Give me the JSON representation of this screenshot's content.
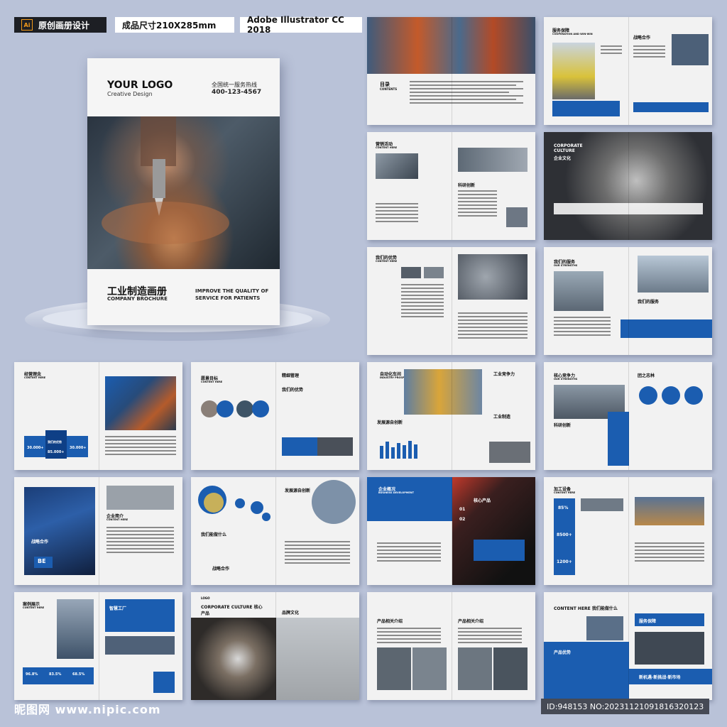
{
  "header": {
    "ai_label": "Ai",
    "tag1": "原创画册设计",
    "tag2": "成品尺寸210X285mm",
    "tag3": "Adobe Illustrator CC 2018"
  },
  "cover": {
    "logo": "YOUR LOGO",
    "logo_sub": "Creative Design",
    "hotline": "全国统一服务热线",
    "phone": "400-123-4567",
    "title": "工业制造画册",
    "title_en": "COMPANY BROCHURE",
    "slogan": "IMPROVE THE QUALITY OF SERVICE FOR PATIENTS"
  },
  "spreads": {
    "s1": {
      "title": "目录",
      "sub": "CONTENTS"
    },
    "s2": {
      "title_left": "服务保障",
      "sub_left": "COOPERATION AND WIN-WIN",
      "title_right": "战略合作"
    },
    "s3": {
      "title": "营销活动",
      "sub": "CONTENT HERE",
      "right": "科研创新"
    },
    "s4": {
      "title": "CORPORATE CULTURE",
      "sub": "企业文化"
    },
    "s5": {
      "title": "我们的优势",
      "sub": "CONTENT HERE"
    },
    "s6": {
      "title": "我们的服务",
      "sub": "OUR STRENGTHS",
      "right": "我们的服务"
    },
    "s7": {
      "title": "经营理念",
      "sub": "CONTENT HERE",
      "stat1": "30.000+",
      "stat2": "85.000+",
      "stat3": "30.000+",
      "center": "我们的优势"
    },
    "s8": {
      "title": "愿景目标",
      "sub": "CONTENT HERE",
      "right": "精细管理",
      "right2": "我们的优势"
    },
    "s9": {
      "title": "自动化车间",
      "sub": "INDUSTRY PROSPECTS",
      "right": "工业竞争力",
      "right2": "工业制造",
      "mid": "发展源自创新"
    },
    "s10": {
      "title": "核心竞争力",
      "sub": "OUR STRENGTHS",
      "right": "团之志林",
      "left2": "科研创新"
    },
    "s11": {
      "title": "企业简介",
      "sub": "CONTENT HERE",
      "badge": "BE",
      "left": "战略合作"
    },
    "s12": {
      "title": "发展源自创新",
      "left": "我们能做什么",
      "left2": "战略合作"
    },
    "s13": {
      "title": "企业概况",
      "sub": "BUSINESS DEVELOPMENT",
      "right": "核心产品",
      "num1": "01",
      "num2": "02"
    },
    "s14": {
      "title": "加工设备",
      "sub": "CONTENT HERE",
      "stat1": "85%",
      "stat2": "8500+",
      "stat3": "1200+"
    },
    "s15": {
      "title": "案例展示",
      "sub": "CONTENT HERE",
      "right": "智慧工厂",
      "stat1": "96.8%",
      "stat2": "83.5%",
      "stat3": "68.5%"
    },
    "s16": {
      "title": "CORPORATE CULTURE 核心产品",
      "right": "品牌文化",
      "logo": "LOGO"
    },
    "s17": {
      "title": "产品相关介绍",
      "right": "产品相关介绍"
    },
    "s18": {
      "title": "CONTENT HERE 我们能做什么",
      "right": "服务保障",
      "blue": "产品优势",
      "banner": "新机遇·新挑战·新市场"
    }
  },
  "footer": {
    "watermark": "昵图网 www.nipic.com",
    "id": "ID:948153 NO:20231121091816320123"
  },
  "colors": {
    "accent": "#1b5db0",
    "bg": "#b9c2d8"
  }
}
